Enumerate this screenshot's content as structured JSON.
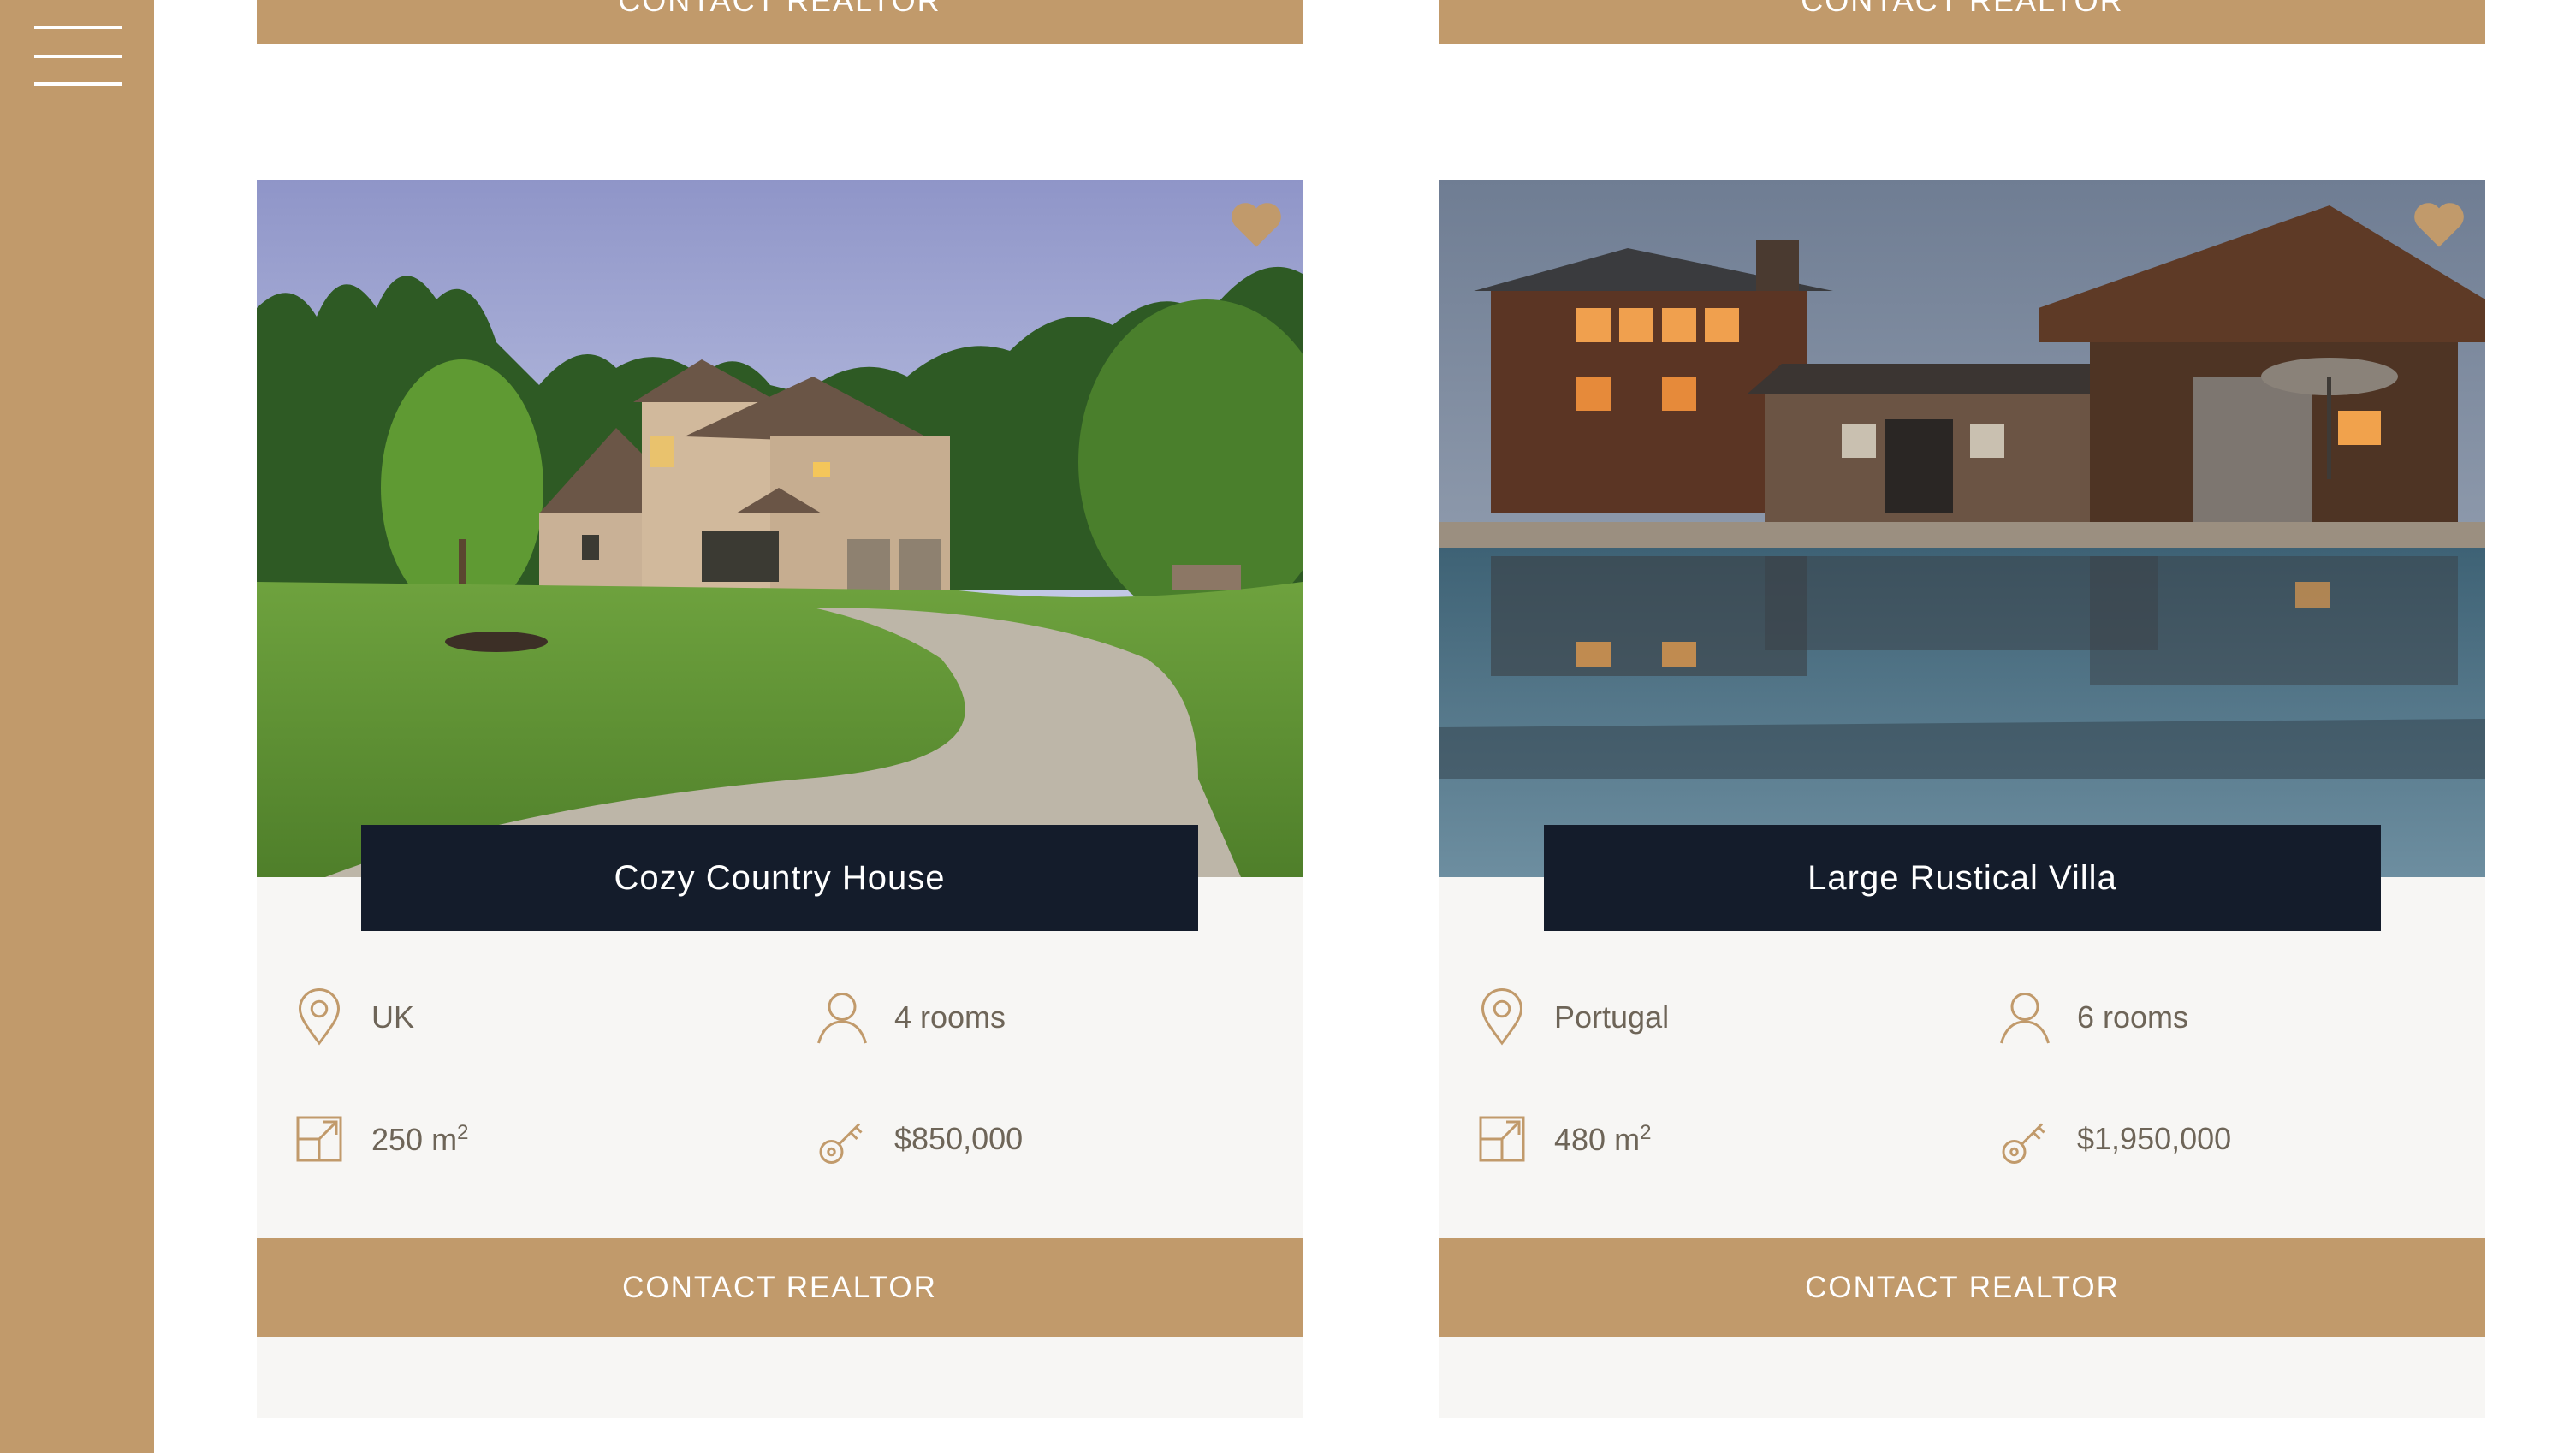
{
  "sidebar": {
    "menu_icon": "hamburger-menu-icon"
  },
  "top_row": {
    "button_label": "CONTACT REALTOR"
  },
  "listings": [
    {
      "title": "Cozy Country House",
      "location": "UK",
      "rooms": "4 rooms",
      "area": "250 m",
      "area_unit_sup": "2",
      "price": "$850,000",
      "button_label": "CONTACT REALTOR"
    },
    {
      "title": "Large Rustical Villa",
      "location": "Portugal",
      "rooms": "6 rooms",
      "area": "480 m",
      "area_unit_sup": "2",
      "price": "$1,950,000",
      "button_label": "CONTACT REALTOR"
    }
  ],
  "icons": {
    "favorite": "heart-icon",
    "location": "map-pin-icon",
    "rooms": "person-icon",
    "area": "resize-square-icon",
    "price": "key-icon"
  },
  "colors": {
    "accent": "#c19a6b",
    "title_bg": "#141c2b",
    "details_bg": "#f7f6f4",
    "text": "#6e6558"
  }
}
